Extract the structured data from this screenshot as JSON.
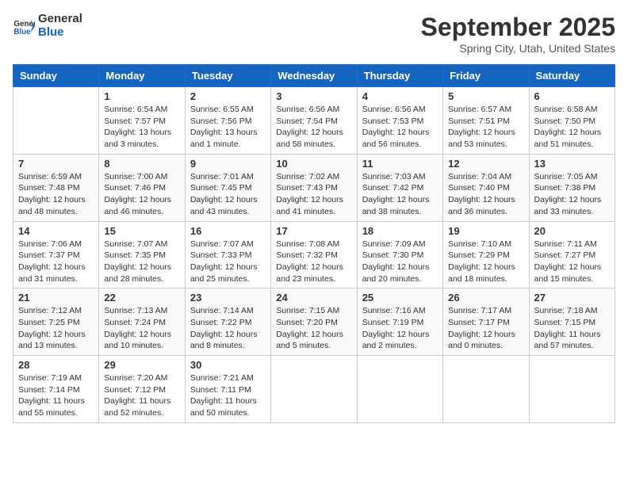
{
  "header": {
    "logo_line1": "General",
    "logo_line2": "Blue",
    "month": "September 2025",
    "location": "Spring City, Utah, United States"
  },
  "days_of_week": [
    "Sunday",
    "Monday",
    "Tuesday",
    "Wednesday",
    "Thursday",
    "Friday",
    "Saturday"
  ],
  "weeks": [
    [
      {
        "day": "",
        "sunrise": "",
        "sunset": "",
        "daylight": ""
      },
      {
        "day": "1",
        "sunrise": "Sunrise: 6:54 AM",
        "sunset": "Sunset: 7:57 PM",
        "daylight": "Daylight: 13 hours and 3 minutes."
      },
      {
        "day": "2",
        "sunrise": "Sunrise: 6:55 AM",
        "sunset": "Sunset: 7:56 PM",
        "daylight": "Daylight: 13 hours and 1 minute."
      },
      {
        "day": "3",
        "sunrise": "Sunrise: 6:56 AM",
        "sunset": "Sunset: 7:54 PM",
        "daylight": "Daylight: 12 hours and 58 minutes."
      },
      {
        "day": "4",
        "sunrise": "Sunrise: 6:56 AM",
        "sunset": "Sunset: 7:53 PM",
        "daylight": "Daylight: 12 hours and 56 minutes."
      },
      {
        "day": "5",
        "sunrise": "Sunrise: 6:57 AM",
        "sunset": "Sunset: 7:51 PM",
        "daylight": "Daylight: 12 hours and 53 minutes."
      },
      {
        "day": "6",
        "sunrise": "Sunrise: 6:58 AM",
        "sunset": "Sunset: 7:50 PM",
        "daylight": "Daylight: 12 hours and 51 minutes."
      }
    ],
    [
      {
        "day": "7",
        "sunrise": "Sunrise: 6:59 AM",
        "sunset": "Sunset: 7:48 PM",
        "daylight": "Daylight: 12 hours and 48 minutes."
      },
      {
        "day": "8",
        "sunrise": "Sunrise: 7:00 AM",
        "sunset": "Sunset: 7:46 PM",
        "daylight": "Daylight: 12 hours and 46 minutes."
      },
      {
        "day": "9",
        "sunrise": "Sunrise: 7:01 AM",
        "sunset": "Sunset: 7:45 PM",
        "daylight": "Daylight: 12 hours and 43 minutes."
      },
      {
        "day": "10",
        "sunrise": "Sunrise: 7:02 AM",
        "sunset": "Sunset: 7:43 PM",
        "daylight": "Daylight: 12 hours and 41 minutes."
      },
      {
        "day": "11",
        "sunrise": "Sunrise: 7:03 AM",
        "sunset": "Sunset: 7:42 PM",
        "daylight": "Daylight: 12 hours and 38 minutes."
      },
      {
        "day": "12",
        "sunrise": "Sunrise: 7:04 AM",
        "sunset": "Sunset: 7:40 PM",
        "daylight": "Daylight: 12 hours and 36 minutes."
      },
      {
        "day": "13",
        "sunrise": "Sunrise: 7:05 AM",
        "sunset": "Sunset: 7:38 PM",
        "daylight": "Daylight: 12 hours and 33 minutes."
      }
    ],
    [
      {
        "day": "14",
        "sunrise": "Sunrise: 7:06 AM",
        "sunset": "Sunset: 7:37 PM",
        "daylight": "Daylight: 12 hours and 31 minutes."
      },
      {
        "day": "15",
        "sunrise": "Sunrise: 7:07 AM",
        "sunset": "Sunset: 7:35 PM",
        "daylight": "Daylight: 12 hours and 28 minutes."
      },
      {
        "day": "16",
        "sunrise": "Sunrise: 7:07 AM",
        "sunset": "Sunset: 7:33 PM",
        "daylight": "Daylight: 12 hours and 25 minutes."
      },
      {
        "day": "17",
        "sunrise": "Sunrise: 7:08 AM",
        "sunset": "Sunset: 7:32 PM",
        "daylight": "Daylight: 12 hours and 23 minutes."
      },
      {
        "day": "18",
        "sunrise": "Sunrise: 7:09 AM",
        "sunset": "Sunset: 7:30 PM",
        "daylight": "Daylight: 12 hours and 20 minutes."
      },
      {
        "day": "19",
        "sunrise": "Sunrise: 7:10 AM",
        "sunset": "Sunset: 7:29 PM",
        "daylight": "Daylight: 12 hours and 18 minutes."
      },
      {
        "day": "20",
        "sunrise": "Sunrise: 7:11 AM",
        "sunset": "Sunset: 7:27 PM",
        "daylight": "Daylight: 12 hours and 15 minutes."
      }
    ],
    [
      {
        "day": "21",
        "sunrise": "Sunrise: 7:12 AM",
        "sunset": "Sunset: 7:25 PM",
        "daylight": "Daylight: 12 hours and 13 minutes."
      },
      {
        "day": "22",
        "sunrise": "Sunrise: 7:13 AM",
        "sunset": "Sunset: 7:24 PM",
        "daylight": "Daylight: 12 hours and 10 minutes."
      },
      {
        "day": "23",
        "sunrise": "Sunrise: 7:14 AM",
        "sunset": "Sunset: 7:22 PM",
        "daylight": "Daylight: 12 hours and 8 minutes."
      },
      {
        "day": "24",
        "sunrise": "Sunrise: 7:15 AM",
        "sunset": "Sunset: 7:20 PM",
        "daylight": "Daylight: 12 hours and 5 minutes."
      },
      {
        "day": "25",
        "sunrise": "Sunrise: 7:16 AM",
        "sunset": "Sunset: 7:19 PM",
        "daylight": "Daylight: 12 hours and 2 minutes."
      },
      {
        "day": "26",
        "sunrise": "Sunrise: 7:17 AM",
        "sunset": "Sunset: 7:17 PM",
        "daylight": "Daylight: 12 hours and 0 minutes."
      },
      {
        "day": "27",
        "sunrise": "Sunrise: 7:18 AM",
        "sunset": "Sunset: 7:15 PM",
        "daylight": "Daylight: 11 hours and 57 minutes."
      }
    ],
    [
      {
        "day": "28",
        "sunrise": "Sunrise: 7:19 AM",
        "sunset": "Sunset: 7:14 PM",
        "daylight": "Daylight: 11 hours and 55 minutes."
      },
      {
        "day": "29",
        "sunrise": "Sunrise: 7:20 AM",
        "sunset": "Sunset: 7:12 PM",
        "daylight": "Daylight: 11 hours and 52 minutes."
      },
      {
        "day": "30",
        "sunrise": "Sunrise: 7:21 AM",
        "sunset": "Sunset: 7:11 PM",
        "daylight": "Daylight: 11 hours and 50 minutes."
      },
      {
        "day": "",
        "sunrise": "",
        "sunset": "",
        "daylight": ""
      },
      {
        "day": "",
        "sunrise": "",
        "sunset": "",
        "daylight": ""
      },
      {
        "day": "",
        "sunrise": "",
        "sunset": "",
        "daylight": ""
      },
      {
        "day": "",
        "sunrise": "",
        "sunset": "",
        "daylight": ""
      }
    ]
  ]
}
